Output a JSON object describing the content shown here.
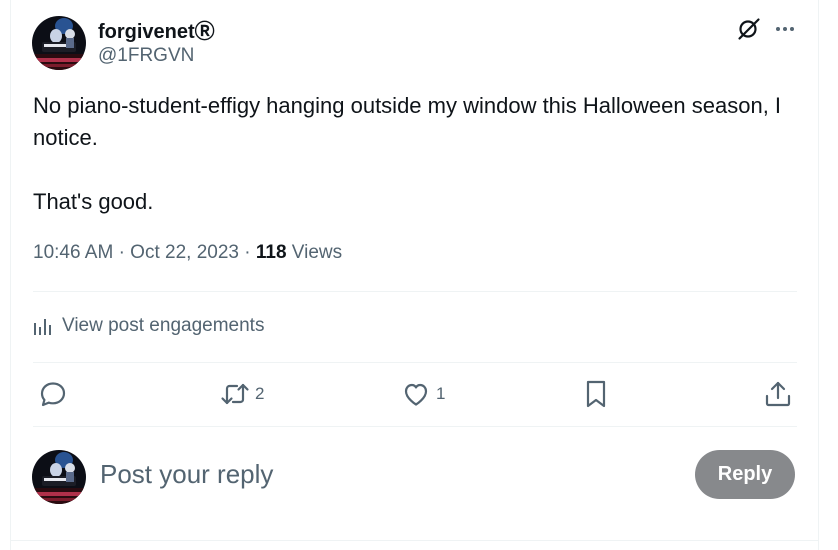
{
  "author": {
    "display_name": "forgivenetⓇ",
    "handle": "@1FRGVN"
  },
  "post": {
    "lines": [
      "No piano-student-effigy hanging outside my window this Halloween season, I notice.",
      "That's good."
    ],
    "time": "10:46 AM",
    "date": "Oct 22, 2023",
    "separator": "·",
    "views_count": "118",
    "views_label": "Views"
  },
  "engagements": {
    "label": "View post engagements",
    "icon": "analytics-bars-icon"
  },
  "actions": {
    "reply": {
      "icon": "reply-bubble-icon",
      "count": ""
    },
    "retweet": {
      "icon": "retweet-icon",
      "count": "2"
    },
    "like": {
      "icon": "heart-icon",
      "count": "1"
    },
    "bookmark": {
      "icon": "bookmark-icon",
      "count": ""
    },
    "share": {
      "icon": "share-upload-icon",
      "count": ""
    }
  },
  "top_icons": [
    "grok-icon",
    "more-dots-icon"
  ],
  "reply_box": {
    "placeholder": "Post your reply",
    "button_label": "Reply"
  },
  "colors": {
    "text_primary": "#0f1419",
    "text_secondary": "#536471",
    "divider": "#eff3f4",
    "reply_button_disabled": "#87898c"
  }
}
